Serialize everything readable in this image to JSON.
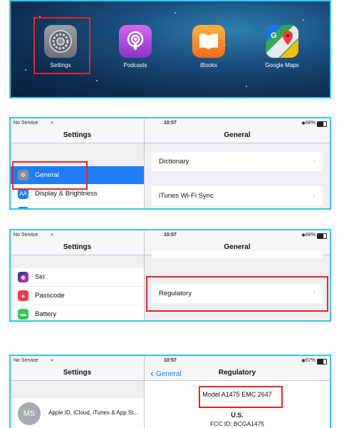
{
  "home": {
    "apps": [
      {
        "label": "Settings",
        "icon": "gear-icon"
      },
      {
        "label": "Podcasts",
        "icon": "podcasts-icon"
      },
      {
        "label": "iBooks",
        "icon": "book-icon"
      },
      {
        "label": "Google Maps",
        "icon": "map-pin-icon"
      }
    ]
  },
  "status": {
    "carrier": "No Service",
    "time": "10:57",
    "battery_a": "68%",
    "battery_b": "68%",
    "battery_c": "67%"
  },
  "step2": {
    "left_title": "Settings",
    "right_title": "General",
    "items": [
      "General",
      "Display & Brightness"
    ],
    "right_items": [
      "Dictionary",
      "iTunes Wi-Fi Sync"
    ]
  },
  "step3": {
    "left_title": "Settings",
    "right_title": "General",
    "items": [
      "Siri",
      "Passcode",
      "Battery"
    ],
    "right_items": [
      "Regulatory"
    ]
  },
  "step4": {
    "left_title": "Settings",
    "right_title": "Regulatory",
    "back_label": "General",
    "avatar_initials": "MS",
    "account_label": "Apple ID, iCloud, iTunes & App St...",
    "model_label": "Model A1475  EMC 2647",
    "country": "U.S.",
    "fcc_label": "FCC ID: BCGA1475"
  },
  "colors": {
    "panel_border": "#34c8e8",
    "highlight": "#e8242c",
    "selected": "#1f7ef6"
  }
}
